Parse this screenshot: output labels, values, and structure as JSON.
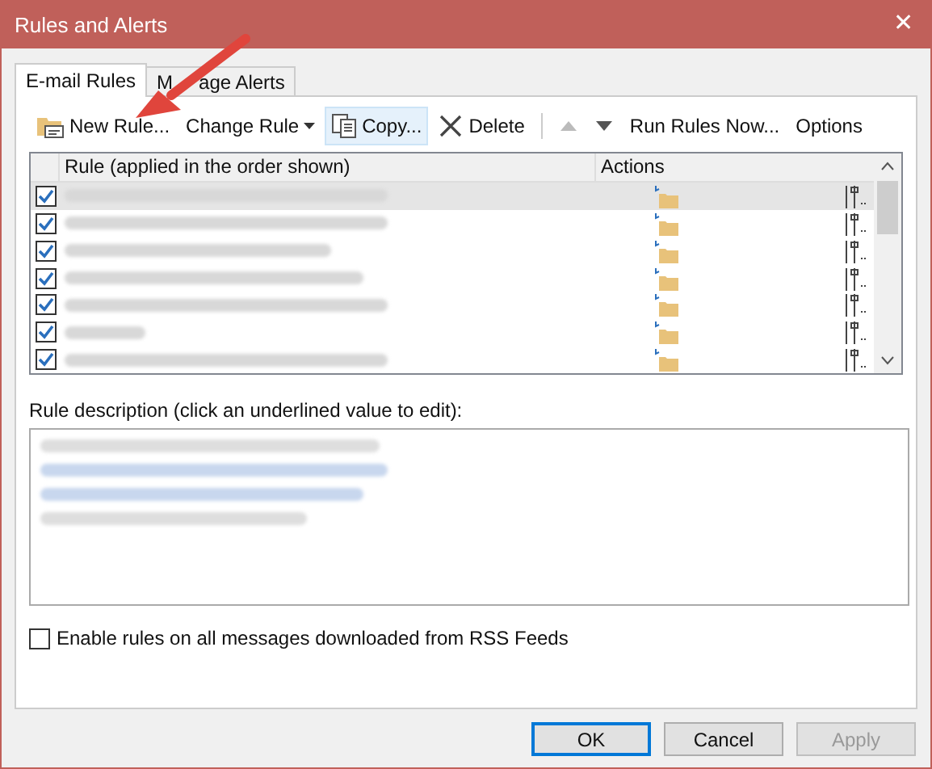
{
  "window": {
    "title": "Rules and Alerts",
    "close": "✕"
  },
  "tabs": [
    {
      "label": "E-mail Rules",
      "selected": true
    },
    {
      "label_parts": [
        "M",
        "age Alerts"
      ],
      "selected": false
    }
  ],
  "toolbar": [
    {
      "kind": "new",
      "label": "New Rule...",
      "disabled": false,
      "selected": false
    },
    {
      "kind": "change",
      "label": "Change Rule",
      "disabled": false,
      "selected": false
    },
    {
      "kind": "copy",
      "label": "Copy...",
      "disabled": false,
      "selected": true
    },
    {
      "kind": "delete",
      "label": "Delete",
      "disabled": false,
      "selected": false
    },
    {
      "kind": "up",
      "disabled": true,
      "selected": false
    },
    {
      "kind": "down",
      "disabled": false,
      "selected": false
    },
    {
      "kind": "run",
      "label": "Run Rules Now...",
      "disabled": false,
      "selected": false
    },
    {
      "kind": "options",
      "label": "Options",
      "disabled": false,
      "selected": false
    }
  ],
  "table": {
    "columns": [
      "Rule (applied in the order shown)",
      "Actions"
    ],
    "rows": [
      {
        "checked": true,
        "selected": true
      },
      {
        "checked": true,
        "selected": false
      },
      {
        "checked": true,
        "selected": false
      },
      {
        "checked": true,
        "selected": false
      },
      {
        "checked": true,
        "selected": false
      },
      {
        "checked": true,
        "selected": false
      },
      {
        "checked": true,
        "selected": false
      }
    ]
  },
  "description": {
    "label": "Rule description (click an underlined value to edit):"
  },
  "rss": {
    "label": "Enable rules on all messages downloaded from RSS Feeds",
    "checked": false
  },
  "buttons": [
    {
      "label": "OK",
      "default": true,
      "disabled": false
    },
    {
      "label": "Cancel",
      "default": false,
      "disabled": false
    },
    {
      "label": "Apply",
      "default": false,
      "disabled": true
    }
  ]
}
